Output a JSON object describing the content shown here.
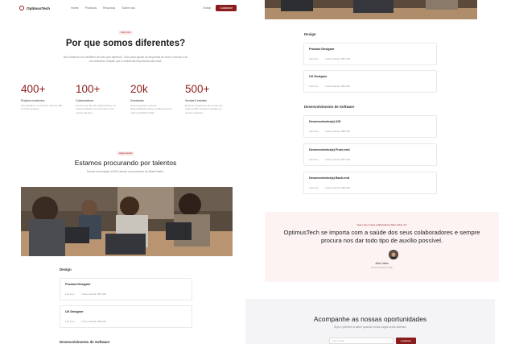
{
  "nav": {
    "brand": "OptimusTech",
    "links": [
      "Home",
      "Produtos",
      "Recursos",
      "Sobre nós"
    ],
    "login": "Entrar",
    "cta": "Cadastrar"
  },
  "about": {
    "eyebrow": "Sobre nós",
    "title": "Por que somos diferentes?",
    "lead": "Nós focamos nos detalhes de tudo que fazemos. Tudo para ajudar as empresas de todo o mundo a se concentrarem naquilo que é realmente importante para elas."
  },
  "stats": [
    {
      "value": "400+",
      "label": "Projetos concluídos",
      "desc": "Nós ajudamos a construir mais de 400 incríveis projetos."
    },
    {
      "value": "100+",
      "label": "Colaboradores",
      "desc": "Temos mais de 100 colaboradores no mesmo trabalho se preocupam com nossos clientes."
    },
    {
      "value": "20k",
      "label": "Downloads",
      "desc": "Nossos projetos quando disponibilizados para o público tiveram mais de 20.000 visitas."
    },
    {
      "value": "500+",
      "label": "Vendas 5 estrelas",
      "desc": "Estamos orgulhosos de contar com mais de 500 vendas 5 estrelas em nossos produtos."
    }
  ],
  "careers": {
    "eyebrow": "Vagas abertas",
    "title": "Estamos procurando por talentos",
    "lead": "Somos uma equipe 100% remota com pessoas de Brasil inteiro."
  },
  "jobs": {
    "group_design": "Design",
    "group_software": "Desenvolvimento de Software",
    "meta_type": "Full-time",
    "design": [
      {
        "title": "Product Designer",
        "salary": "Faixa salarial: R$7.000"
      },
      {
        "title": "UX Designer",
        "salary": "Faixa salarial: R$6.000"
      }
    ],
    "software": [
      {
        "title": "Desenvolvedor(a) iOS",
        "salary": "Faixa salarial: R$8.000"
      },
      {
        "title": "Desenvolvedor(a) Front-end",
        "salary": "Faixa salarial: R$7.000"
      },
      {
        "title": "Desenvolvedor(a) Back-end",
        "salary": "Faixa salarial: R$8.000"
      }
    ]
  },
  "testimonial": {
    "eyebrow": "Veja o que nossos colaboradores falam sobre nós",
    "quote": "OptimusTech se importa com a saúde dos seus colaboradores e sempre procura nos dar todo tipo de auxílio possível.",
    "name": "Júlia Castro",
    "role": "Desenvolvedora Web"
  },
  "newsletter": {
    "title": "Acompanhe as nossas oportunidades",
    "subtitle": "Seja o primeiro a saber quando novas vagas serão abertas!",
    "placeholder": "Seu e-mail",
    "button": "Cadastrar"
  },
  "colors": {
    "accent": "#8b1c1c",
    "accent_soft": "#fdf3f3"
  }
}
